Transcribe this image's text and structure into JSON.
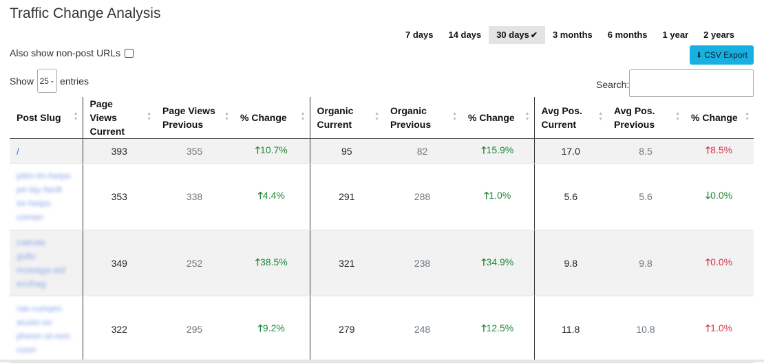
{
  "title": "Traffic Change Analysis",
  "ranges": [
    {
      "label": "7 days",
      "active": false
    },
    {
      "label": "14 days",
      "active": false
    },
    {
      "label": "30 days",
      "active": true
    },
    {
      "label": "3 months",
      "active": false
    },
    {
      "label": "6 months",
      "active": false
    },
    {
      "label": "1 year",
      "active": false
    },
    {
      "label": "2 years",
      "active": false
    }
  ],
  "nonpost_label": "Also show non-post URLs",
  "csv_label": "CSV Export",
  "show_label": "Show",
  "entries_value": "25",
  "entries_label": "entries",
  "search_label": "Search:",
  "columns": [
    "Post Slug",
    "Page Views Current",
    "Page Views Previous",
    "% Change",
    "Organic Current",
    "Organic Previous",
    "% Change",
    "Avg Pos. Current",
    "Avg Pos. Previous",
    "% Change"
  ],
  "rows": [
    {
      "slug": "/",
      "blurred": false,
      "pv_cur": "393",
      "pv_prev": "355",
      "pv_chg": "10.7%",
      "pv_dir": "up",
      "org_cur": "95",
      "org_prev": "82",
      "org_chg": "15.9%",
      "org_dir": "up",
      "pos_cur": "17.0",
      "pos_prev": "8.5",
      "pos_chg": "8.5%",
      "pos_dir": "up-bad"
    },
    {
      "slug": "",
      "blurred": true,
      "pv_cur": "353",
      "pv_prev": "338",
      "pv_chg": "4.4%",
      "pv_dir": "up",
      "org_cur": "291",
      "org_prev": "288",
      "org_chg": "1.0%",
      "org_dir": "up",
      "pos_cur": "5.6",
      "pos_prev": "5.6",
      "pos_chg": "0.0%",
      "pos_dir": "down-good"
    },
    {
      "slug": "",
      "blurred": true,
      "pv_cur": "349",
      "pv_prev": "252",
      "pv_chg": "38.5%",
      "pv_dir": "up",
      "org_cur": "321",
      "org_prev": "238",
      "org_chg": "34.9%",
      "org_dir": "up",
      "pos_cur": "9.8",
      "pos_prev": "9.8",
      "pos_chg": "0.0%",
      "pos_dir": "up-bad"
    },
    {
      "slug": "",
      "blurred": true,
      "pv_cur": "322",
      "pv_prev": "295",
      "pv_chg": "9.2%",
      "pv_dir": "up",
      "org_cur": "279",
      "org_prev": "248",
      "org_chg": "12.5%",
      "org_dir": "up",
      "pos_cur": "11.8",
      "pos_prev": "10.8",
      "pos_chg": "1.0%",
      "pos_dir": "up-bad"
    }
  ],
  "colors": {
    "positive": "#218838",
    "negative": "#dc3545",
    "csv_button": "#17b0e0",
    "active_range": "#e2e3e5"
  },
  "icons": {
    "csv": "download-icon",
    "active_range": "check-icon",
    "sort": "sort-icon",
    "up": "arrow-up-icon",
    "down": "arrow-down-icon"
  }
}
